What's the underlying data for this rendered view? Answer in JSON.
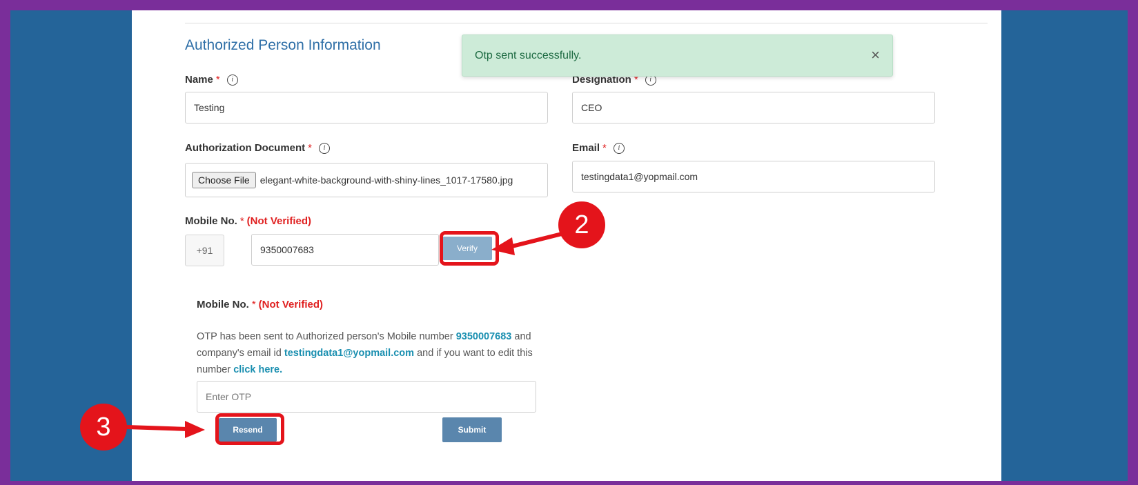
{
  "section": {
    "title": "Authorized Person Information"
  },
  "toast": {
    "message": "Otp sent successfully.",
    "close_glyph": "×"
  },
  "fields": {
    "name": {
      "label": "Name",
      "required": "*",
      "value": "Testing"
    },
    "designation": {
      "label": "Designation",
      "required": "*",
      "value": "CEO"
    },
    "auth_doc": {
      "label": "Authorization Document",
      "required": "*",
      "button": "Choose File",
      "filename": "elegant-white-background-with-shiny-lines_1017-17580.jpg"
    },
    "email": {
      "label": "Email",
      "required": "*",
      "value": "testingdata1@yopmail.com"
    },
    "mobile": {
      "label": "Mobile No.",
      "required": "*",
      "status": "(Not Verified)",
      "prefix": "+91",
      "value": "9350007683",
      "verify_label": "Verify"
    }
  },
  "info_glyph": "i",
  "otp": {
    "label": "Mobile No.",
    "required": "*",
    "status": "(Not Verified)",
    "msg_part1": "OTP has been sent to Authorized person's Mobile number ",
    "msg_number": "9350007683",
    "msg_part2": " and company's email id ",
    "msg_email": "testingdata1@yopmail.com",
    "msg_part3": " and if you want to edit this number ",
    "msg_link": "click here.",
    "input_placeholder": "Enter OTP",
    "resend_label": "Resend",
    "submit_label": "Submit"
  },
  "markers": {
    "step2": "2",
    "step3": "3"
  },
  "colors": {
    "accent": "#e4141b",
    "frame": "#7a2e9a",
    "background": "#246499",
    "button": "#5a86ad",
    "toast": "#cdebd8"
  }
}
